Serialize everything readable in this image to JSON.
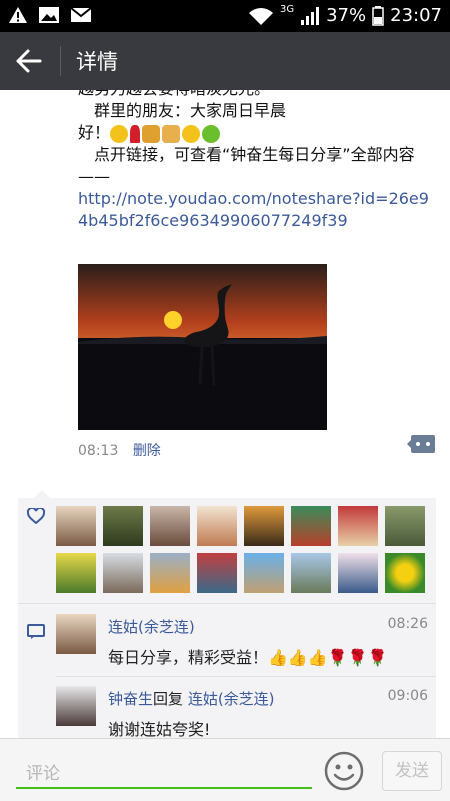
{
  "status_bar": {
    "network": "3G",
    "battery": "37%",
    "time": "23:07"
  },
  "header": {
    "title": "详情"
  },
  "post": {
    "text_cut": "越努力越会要得暗淡无光。",
    "text_line2": "群里的朋友：大家周日早晨",
    "text_line3": "好！",
    "text_line4": "点开链接，可查看“钟奋生每日分享”全部内容——",
    "link": "http://note.youdao.com/noteshare?id=26e94b45bf2f6ce96349906077249f39",
    "time": "08:13",
    "delete_label": "删除"
  },
  "colors": {
    "accent": "#45c01a",
    "link": "#3b5a9a",
    "titlebar": "#393a3f"
  },
  "comments": [
    {
      "name": "连姑(余芝连)",
      "time": "08:26",
      "text": "每日分享，精彩受益！👍👍👍🌹🌹🌹"
    },
    {
      "name": "钟奋生",
      "reply_word": "回复",
      "reply_to": "连姑(余芝连)",
      "time": "09:06",
      "text": "谢谢连姑夸奖!"
    }
  ],
  "input": {
    "placeholder": "评论",
    "send_label": "发送"
  }
}
